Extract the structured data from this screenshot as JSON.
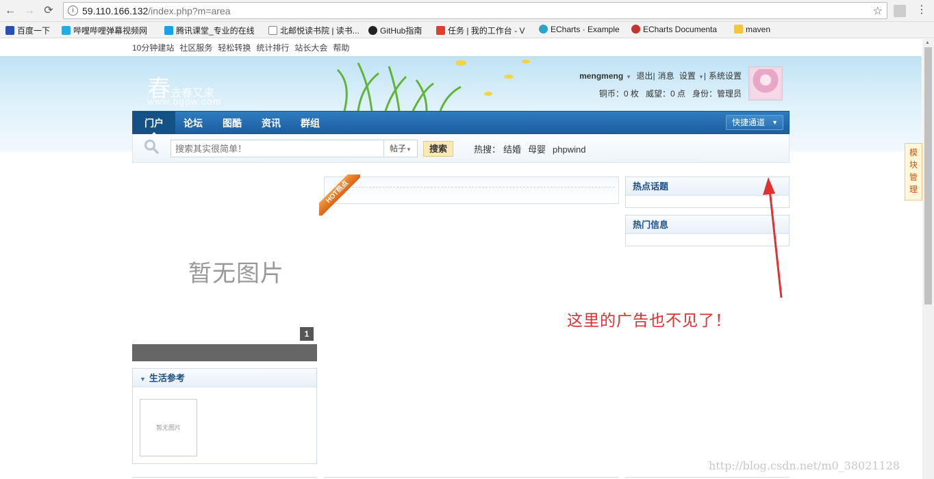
{
  "browser": {
    "url_host": "59.110.166.132",
    "url_path": "/index.php?m=area",
    "bookmarks": [
      {
        "label": "百度一下",
        "color": "#2a4fb4"
      },
      {
        "label": "哔哩哔哩弹幕视频网",
        "color": "#23ade5"
      },
      {
        "label": "腾讯课堂_专业的在线",
        "color": "#19a0e6"
      },
      {
        "label": "北邮悦读书院 | 读书...",
        "color": "#888888"
      },
      {
        "label": "GitHub指南",
        "color": "#222222"
      },
      {
        "label": "任务 | 我的工作台 - V",
        "color": "#e0402b"
      },
      {
        "label": "ECharts · Example",
        "color": "#2ca3c9"
      },
      {
        "label": "ECharts Documenta",
        "color": "#c23531"
      },
      {
        "label": "maven",
        "color": "#f4c542"
      }
    ]
  },
  "topnav": [
    "10分钟建站",
    "社区服务",
    "轻松转换",
    "统计排行",
    "站长大会",
    "帮助"
  ],
  "header": {
    "logo_text": "春",
    "logo_small": "去春又来",
    "logo_sub": "www.bgpw.com",
    "username": "mengmeng",
    "logout": "退出",
    "messages": "消息",
    "settings": "设置",
    "system_settings": "系统设置",
    "coins": "铜币：0 枚",
    "prestige": "威望：0 点",
    "identity": "身份：管理员"
  },
  "mainnav": {
    "items": [
      "门户",
      "论坛",
      "图酷",
      "资讯",
      "群组"
    ],
    "quick": "快捷通道"
  },
  "search": {
    "placeholder": "搜索其实很简单！",
    "scope": "帖子",
    "button": "搜索",
    "hot_label": "热搜：",
    "hot_terms": [
      "结婚",
      "母婴",
      "phpwind"
    ]
  },
  "slider": {
    "no_image": "暂无图片",
    "index": "1"
  },
  "hot_panel": {
    "ribbon": "HOT热点"
  },
  "side": {
    "hot_topics": "热点话题",
    "hot_info": "热门信息"
  },
  "life": {
    "title": "生活参考",
    "no_image": "暂无图片"
  },
  "side_tab": [
    "模",
    "块",
    "管",
    "理"
  ],
  "annotation": "这里的广告也不见了！",
  "watermark": "http://blog.csdn.net/m0_38021128"
}
